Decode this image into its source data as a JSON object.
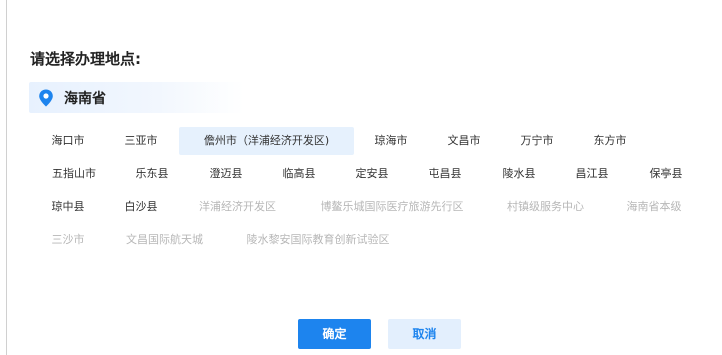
{
  "dialog": {
    "title": "请选择办理地点:",
    "province": "海南省"
  },
  "locations": [
    {
      "name": "海口市",
      "state": "enabled"
    },
    {
      "name": "三亚市",
      "state": "enabled"
    },
    {
      "name": "儋州市（洋浦经济开发区)",
      "state": "selected"
    },
    {
      "name": "琼海市",
      "state": "enabled"
    },
    {
      "name": "文昌市",
      "state": "enabled"
    },
    {
      "name": "万宁市",
      "state": "enabled"
    },
    {
      "name": "东方市",
      "state": "enabled"
    },
    {
      "name": "五指山市",
      "state": "enabled"
    },
    {
      "name": "乐东县",
      "state": "enabled"
    },
    {
      "name": "澄迈县",
      "state": "enabled"
    },
    {
      "name": "临高县",
      "state": "enabled"
    },
    {
      "name": "定安县",
      "state": "enabled"
    },
    {
      "name": "屯昌县",
      "state": "enabled"
    },
    {
      "name": "陵水县",
      "state": "enabled"
    },
    {
      "name": "昌江县",
      "state": "enabled"
    },
    {
      "name": "保亭县",
      "state": "enabled"
    },
    {
      "name": "琼中县",
      "state": "enabled"
    },
    {
      "name": "白沙县",
      "state": "enabled"
    },
    {
      "name": "洋浦经济开发区",
      "state": "disabled"
    },
    {
      "name": "博鳌乐城国际医疗旅游先行区",
      "state": "disabled"
    },
    {
      "name": "村镇级服务中心",
      "state": "disabled"
    },
    {
      "name": "海南省本级",
      "state": "disabled"
    },
    {
      "name": "三沙市",
      "state": "disabled"
    },
    {
      "name": "文昌国际航天城",
      "state": "disabled"
    },
    {
      "name": "陵水黎安国际教育创新试验区",
      "state": "disabled"
    }
  ],
  "buttons": {
    "confirm": "确定",
    "cancel": "取消"
  },
  "colors": {
    "primary": "#1d84ee",
    "selected_bg": "#e6f1fd",
    "disabled_text": "#b7b7b7"
  }
}
